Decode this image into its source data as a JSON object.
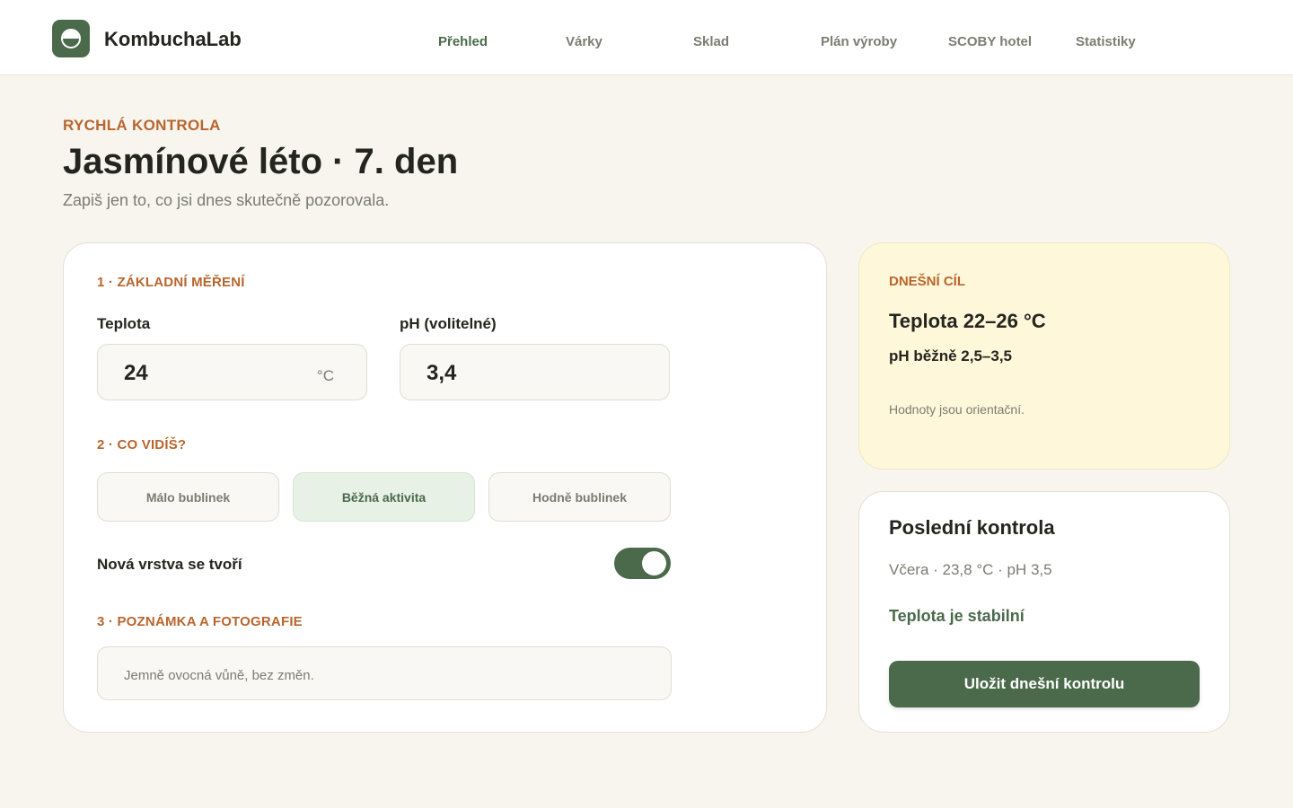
{
  "app": {
    "brand": "KombuchaLab",
    "logo_icon": "kombucha-jar-icon"
  },
  "nav": {
    "items": [
      {
        "label": "Přehled",
        "active": true
      },
      {
        "label": "Várky",
        "active": false
      },
      {
        "label": "Sklad",
        "active": false
      },
      {
        "label": "Plán výroby",
        "active": false
      },
      {
        "label": "SCOBY hotel",
        "active": false
      },
      {
        "label": "Statistiky",
        "active": false
      }
    ]
  },
  "header": {
    "eyebrow": "RYCHLÁ KONTROLA",
    "title": "Jasmínové léto · 7. den",
    "subtitle": "Zapiš jen to, co jsi dnes skutečně pozorovala."
  },
  "form": {
    "section1": "1 · ZÁKLADNÍ MĚŘENÍ",
    "temperature": {
      "label": "Teplota",
      "value": "24",
      "unit": "°C"
    },
    "ph": {
      "label": "pH (volitelné)",
      "value": "3,4"
    },
    "section2": "2 · CO VIDÍŠ?",
    "activity_options": [
      {
        "label": "Málo bublinek",
        "selected": false
      },
      {
        "label": "Běžná aktivita",
        "selected": true
      },
      {
        "label": "Hodně bublinek",
        "selected": false
      }
    ],
    "new_layer": {
      "label": "Nová vrstva se tvoří",
      "on": true
    },
    "section3": "3 · POZNÁMKA A FOTOGRAFIE",
    "note": {
      "value": "Jemně ovocná vůně, bez změn."
    }
  },
  "goal": {
    "eyebrow": "DNEŠNÍ CÍL",
    "temperature": "Teplota 22–26 °C",
    "ph": "pH běžně 2,5–3,5",
    "note": "Hodnoty jsou orientační."
  },
  "last_check": {
    "title": "Poslední kontrola",
    "summary": "Včera · 23,8 °C · pH 3,5",
    "status": "Teplota je stabilní",
    "save_label": "Uložit dnešní kontrolu"
  },
  "colors": {
    "accent": "#4a6a4b",
    "eyebrow": "#b8652d",
    "background": "#f7f5ee",
    "goal_card": "#fef7da"
  }
}
